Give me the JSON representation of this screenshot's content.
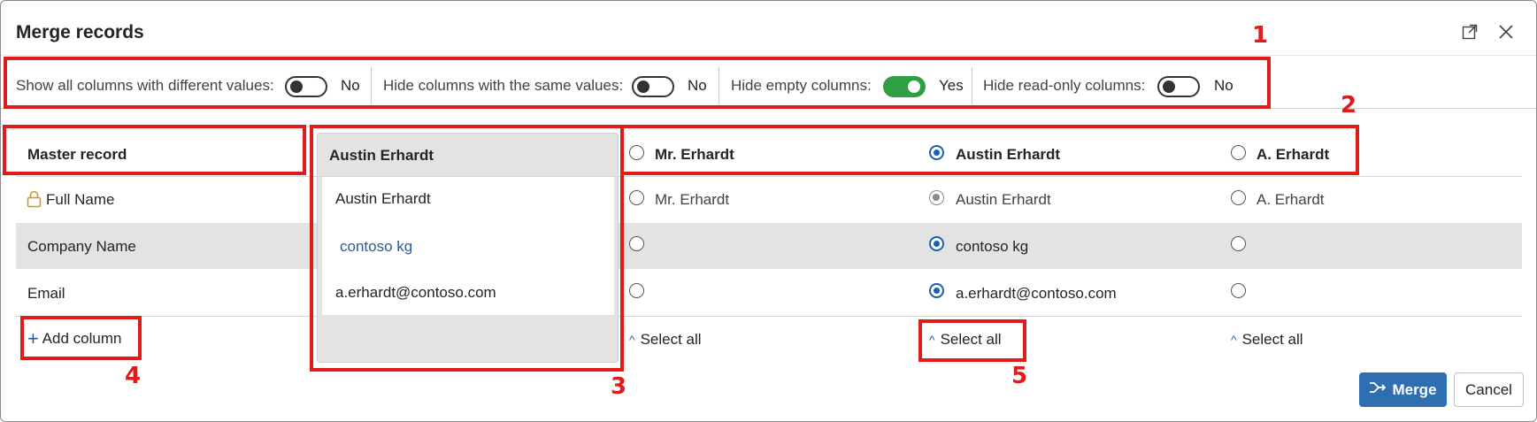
{
  "dialog": {
    "title": "Merge records",
    "expand_icon": "expand-icon",
    "close_icon": "close-icon"
  },
  "toggles": [
    {
      "label": "Show all columns with different values:",
      "value": "No",
      "on": false
    },
    {
      "label": "Hide columns with the same values:",
      "value": "No",
      "on": false
    },
    {
      "label": "Hide empty columns:",
      "value": "Yes",
      "on": true
    },
    {
      "label": "Hide read-only columns:",
      "value": "No",
      "on": false
    }
  ],
  "table": {
    "master_header": "Master record",
    "master_record_name": "Austin Erhardt",
    "records": [
      "Mr. Erhardt",
      "Austin Erhardt",
      "A. Erhardt"
    ],
    "selected_record_index": 1,
    "fields": [
      {
        "label": "Full Name",
        "locked": true,
        "master_value": "Austin Erhardt",
        "values": [
          "Mr. Erhardt",
          "Austin Erhardt",
          "A. Erhardt"
        ],
        "selected_index": 1
      },
      {
        "label": "Company Name",
        "locked": false,
        "master_value": "contoso kg",
        "values": [
          "",
          "contoso kg",
          ""
        ],
        "selected_index": 1
      },
      {
        "label": "Email",
        "locked": false,
        "master_value": "a.erhardt@contoso.com",
        "values": [
          "",
          "a.erhardt@contoso.com",
          ""
        ],
        "selected_index": 1
      }
    ],
    "add_column_label": "Add column",
    "select_all_label": "Select all"
  },
  "buttons": {
    "merge": "Merge",
    "cancel": "Cancel"
  },
  "annotations": [
    "1",
    "2",
    "3",
    "4",
    "5"
  ],
  "colors": {
    "accent": "#2f6fb1",
    "toggle_on": "#2ea043",
    "annotation": "#e01b1b",
    "row_highlight": "#e3e3e3"
  }
}
